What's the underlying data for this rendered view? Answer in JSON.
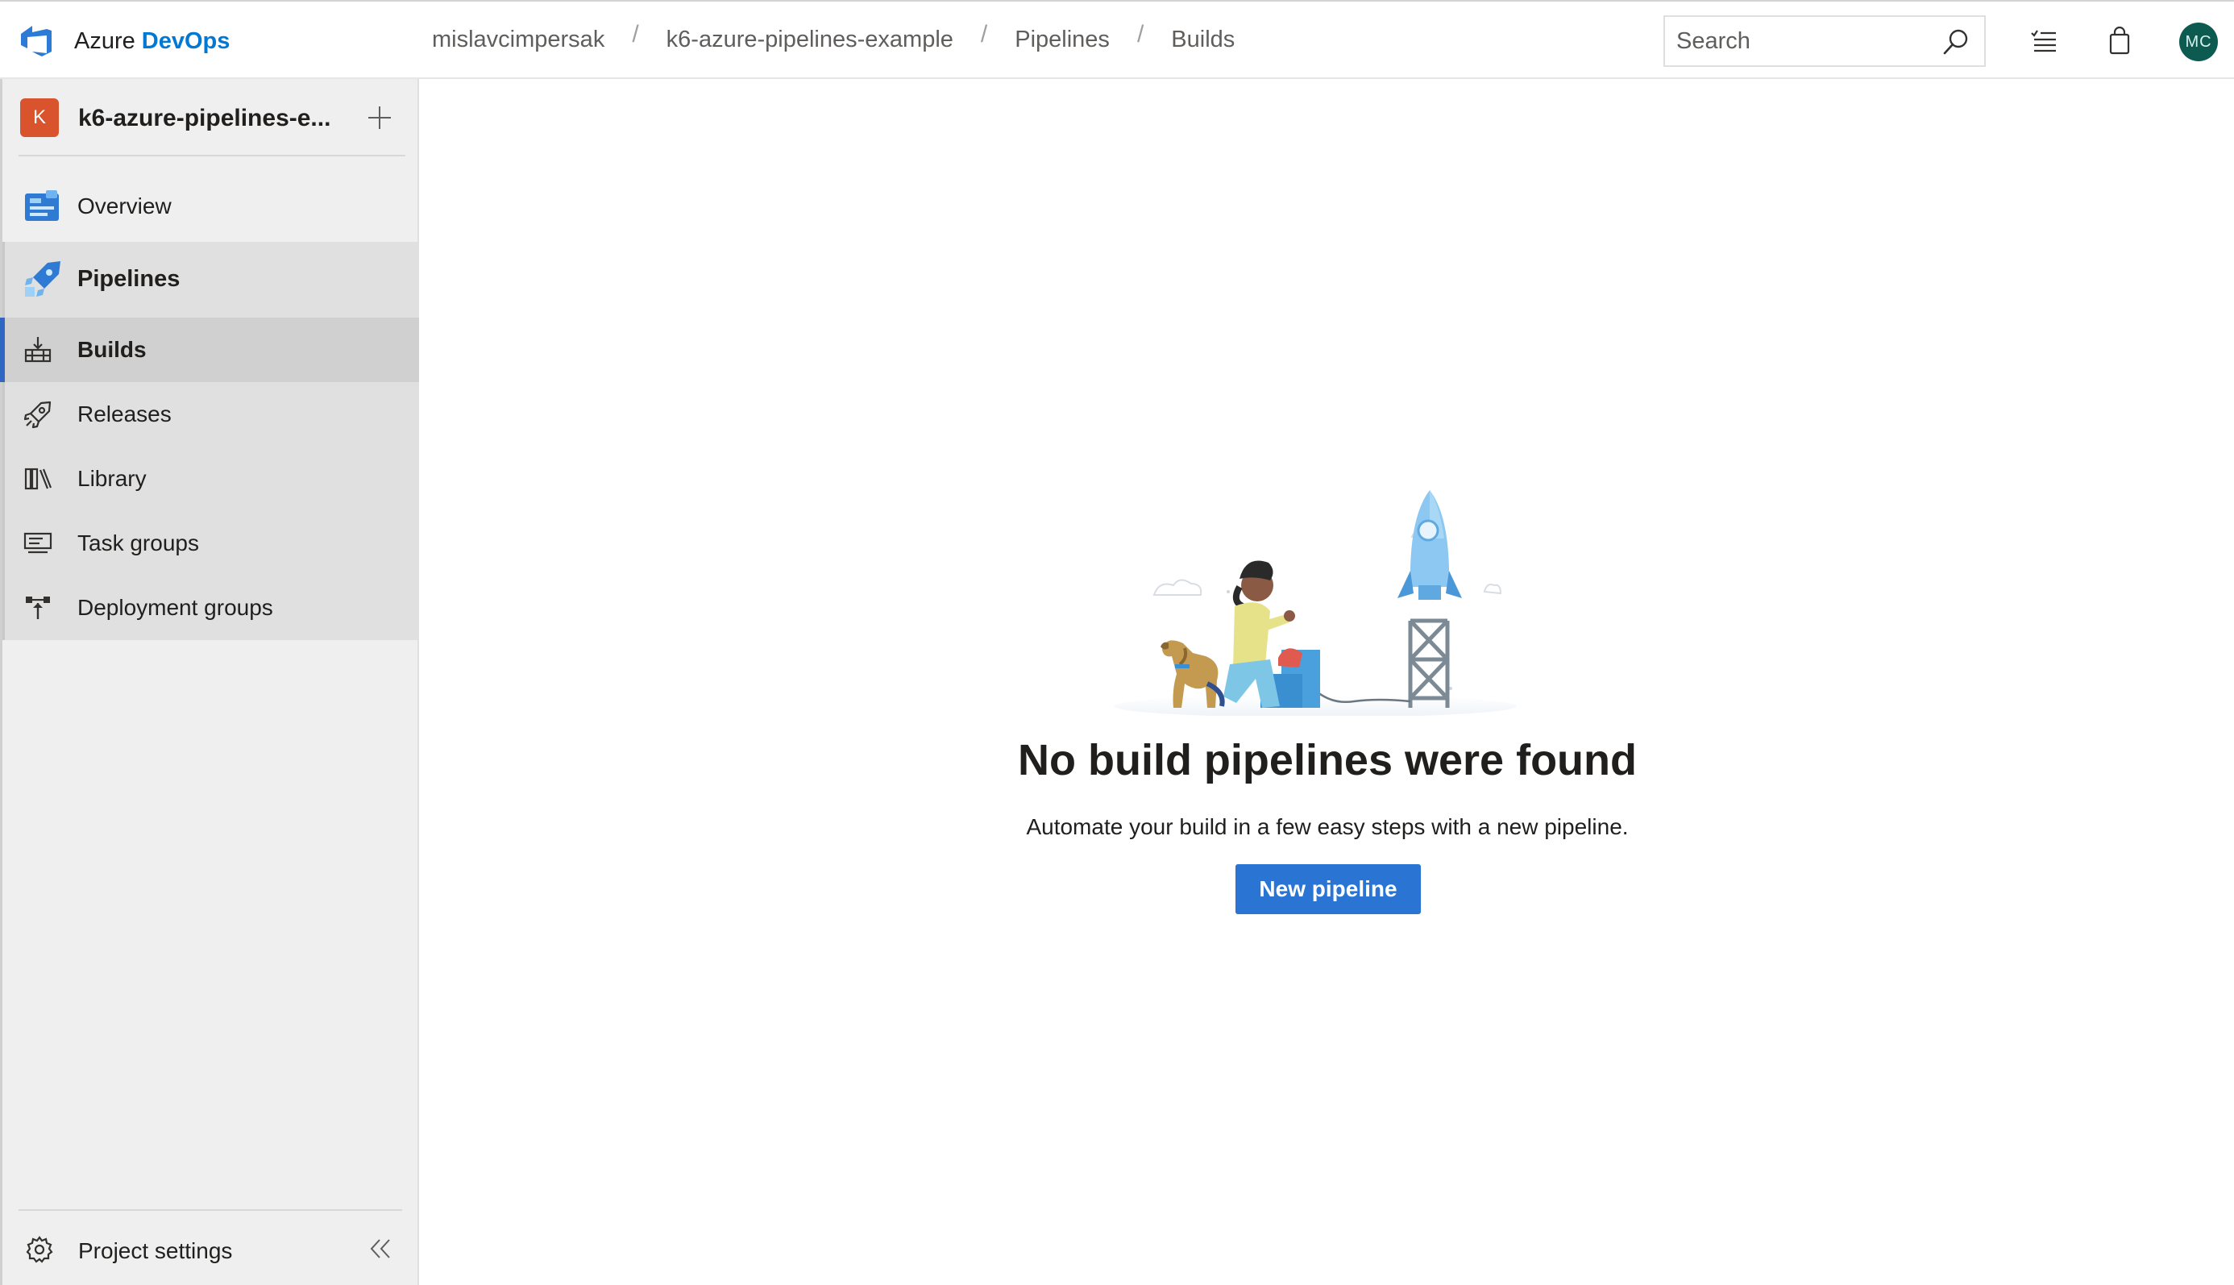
{
  "brand": {
    "name": "Azure",
    "accent": "DevOps",
    "icon": "azure-devops-logo-icon",
    "accent_color": "#0078d4"
  },
  "breadcrumbs": [
    "mislavcimpersak",
    "k6-azure-pipelines-example",
    "Pipelines",
    "Builds"
  ],
  "search": {
    "placeholder": "Search",
    "value": ""
  },
  "topbar_icons": [
    "search-icon",
    "task-list-icon",
    "shopping-bag-icon"
  ],
  "user": {
    "initials": "MC",
    "avatar_color": "#0d5a50"
  },
  "project": {
    "badge": "K",
    "name": "k6-azure-pipelines-e...",
    "badge_color": "#d9532c"
  },
  "sidebar": {
    "items": [
      {
        "label": "Overview",
        "icon": "overview-board-icon"
      },
      {
        "label": "Pipelines",
        "icon": "pipelines-rocket-icon"
      },
      {
        "label": "Builds",
        "icon": "builds-icon",
        "selected": true
      },
      {
        "label": "Releases",
        "icon": "releases-rocket-icon"
      },
      {
        "label": "Library",
        "icon": "library-icon"
      },
      {
        "label": "Task groups",
        "icon": "task-groups-icon"
      },
      {
        "label": "Deployment groups",
        "icon": "deployment-groups-icon"
      }
    ],
    "footer": {
      "label": "Project settings",
      "icon": "gear-icon",
      "collapse_icon": "double-chevron-left-icon"
    }
  },
  "empty_state": {
    "title": "No build pipelines were found",
    "subtitle": "Automate your build in a few easy steps with a new pipeline.",
    "button_label": "New pipeline",
    "button_color": "#2a75d3"
  }
}
